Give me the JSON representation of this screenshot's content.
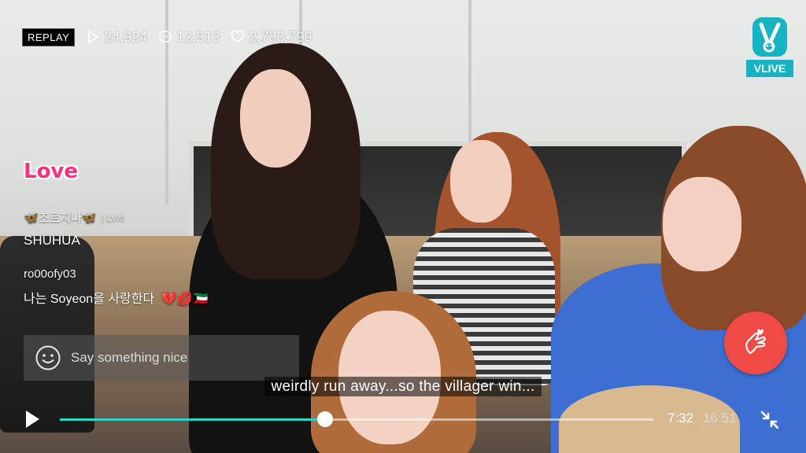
{
  "player": {
    "replay_label": "REPLAY",
    "views": "24,924",
    "comments": "12,513",
    "likes": "2,783,799",
    "current_time": "7:32",
    "duration": "16:51",
    "progress_fraction": 0.447,
    "subtitle": "weirdly run away...so the villager win..."
  },
  "brand": {
    "logo_text": "VLIVE",
    "accent_color": "#16b3c2"
  },
  "sticker": {
    "text": "Love"
  },
  "chat": {
    "comments": [
      {
        "user": "🦋조르지나🦋",
        "level": "| LV.6",
        "message": "SHUHUA"
      },
      {
        "user": "ro00ofy03",
        "message": "나는 Soyeon을 사랑한다",
        "emojis": "💔💋🇰🇼"
      }
    ],
    "input_placeholder": "Say something nice"
  },
  "icons": {
    "play": "play-icon",
    "views": "play-outline-icon",
    "comments": "chat-bubble-icon",
    "likes": "heart-outline-icon",
    "emoji": "smiley-icon",
    "heart_button": "finger-heart-icon",
    "collapse": "collapse-arrows-icon"
  },
  "colors": {
    "progress": "#2cd3c7",
    "heart_button": "#f04a46"
  }
}
